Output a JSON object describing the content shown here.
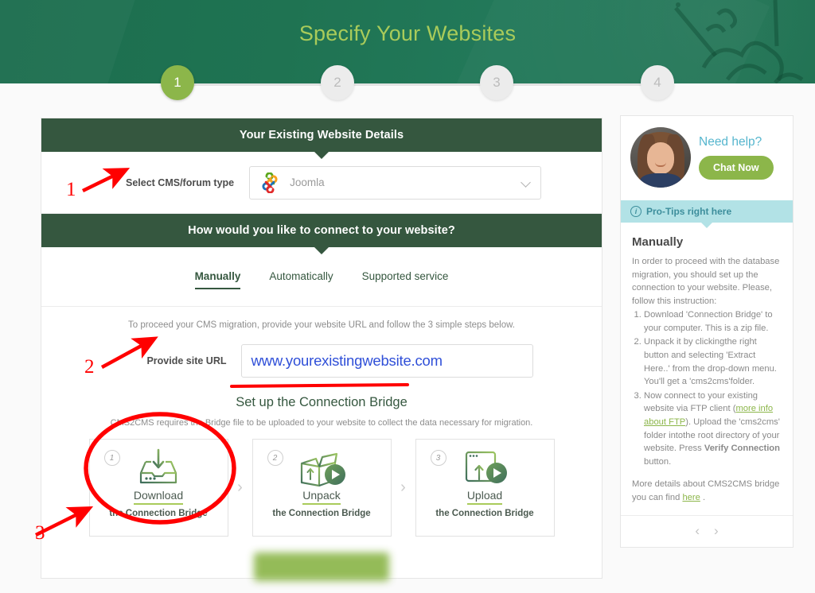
{
  "header": {
    "title": "Specify Your Websites",
    "title_color": "#a9cb5a",
    "bg_color": "#1f7352"
  },
  "stepper": {
    "steps": [
      {
        "label": "1",
        "state": "done"
      },
      {
        "label": "2",
        "state": "todo"
      },
      {
        "label": "3",
        "state": "todo"
      },
      {
        "label": "4",
        "state": "todo"
      }
    ],
    "active_color": "#8cb64a"
  },
  "main": {
    "section1_title": "Your Existing Website Details",
    "cms_label": "Select CMS/forum type",
    "cms_value": "Joomla",
    "cms_icon": "joomla-logo",
    "section2_title": "How would you like to connect to your website?",
    "tabs": [
      {
        "label": "Manually",
        "active": true
      },
      {
        "label": "Automatically",
        "active": false
      },
      {
        "label": "Supported service",
        "active": false
      }
    ],
    "hint": "To proceed your CMS migration, provide your website URL and follow the 3 simple steps below.",
    "url_label": "Provide site URL",
    "url_value": "www.yourexistingwebsite.com",
    "url_color": "#2f4fd8",
    "bridge_title": "Set up the Connection Bridge",
    "bridge_sub": "CMS2CMS requires the Bridge file to be uploaded to your website to collect the data necessary for migration.",
    "cards": [
      {
        "num": "1",
        "title": "Download",
        "sub": "the Connection Bridge",
        "icon": "inbox-download-icon",
        "has_play": false
      },
      {
        "num": "2",
        "title": "Unpack",
        "sub": "the Connection Bridge",
        "icon": "open-box-icon",
        "has_play": true
      },
      {
        "num": "3",
        "title": "Upload",
        "sub": "the Connection Bridge",
        "icon": "browser-upload-icon",
        "has_play": true
      }
    ],
    "card_separator": "›"
  },
  "sidebar": {
    "need_help": "Need help?",
    "chat_button": "Chat Now",
    "protip_banner": "Pro-Tips right here",
    "tips_heading": "Manually",
    "tips_intro": "In order to proceed with the database migration, you should set up the connection to your website. Please, follow this instruction:",
    "tips_steps": [
      "Download 'Connection Bridge' to your computer. This is a zip file.",
      "Unpack it by clickingthe right button and selecting 'Extract Here..' from the drop-down menu. You'll get a 'cms2cms'folder.",
      "Now connect to your existing website via FTP client ( more info about FTP ). Upload the 'cms2cms' folder intothe root directory of your website. Press 'Verify Connection' button."
    ],
    "step3_link": "more info about FTP",
    "step3_bold": "Verify Connection",
    "more_details": "More details about CMS2CMS bridge you can find",
    "more_details_link": "here",
    "nav_prev": "‹",
    "nav_next": "›"
  },
  "annotations": {
    "color": "#ff0000",
    "markers": [
      {
        "label": "1",
        "target": "Select CMS/forum type"
      },
      {
        "label": "2",
        "target": "Provide site URL"
      },
      {
        "label": "3",
        "target": "Download the Connection Bridge card"
      }
    ],
    "underline_target": "Set up the Connection Bridge",
    "circle_target": "Download card"
  }
}
